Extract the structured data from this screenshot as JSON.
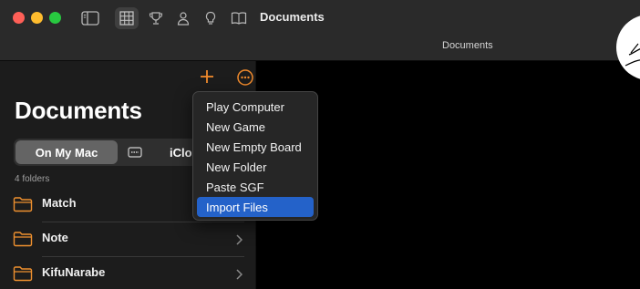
{
  "window": {
    "title": "Documents",
    "tab_title": "Documents"
  },
  "toolbar": {
    "icons": [
      "sidebar-toggle-icon",
      "board-grid-icon",
      "trophy-icon",
      "person-icon",
      "lightbulb-icon",
      "book-icon"
    ]
  },
  "sidebar": {
    "title": "Documents",
    "segments": [
      "On My Mac",
      "iClo"
    ],
    "folder_count": "4 folders",
    "folders": [
      {
        "name": "Match"
      },
      {
        "name": "Note"
      },
      {
        "name": "KifuNarabe"
      }
    ]
  },
  "menu": {
    "items": [
      "Play Computer",
      "New Game",
      "New Empty Board",
      "New Folder",
      "Paste SGF",
      "Import Files"
    ],
    "highlighted": "Import Files"
  },
  "colors": {
    "accent": "#f08a2c",
    "highlight": "#2462c9",
    "folder": "#f0912f"
  }
}
